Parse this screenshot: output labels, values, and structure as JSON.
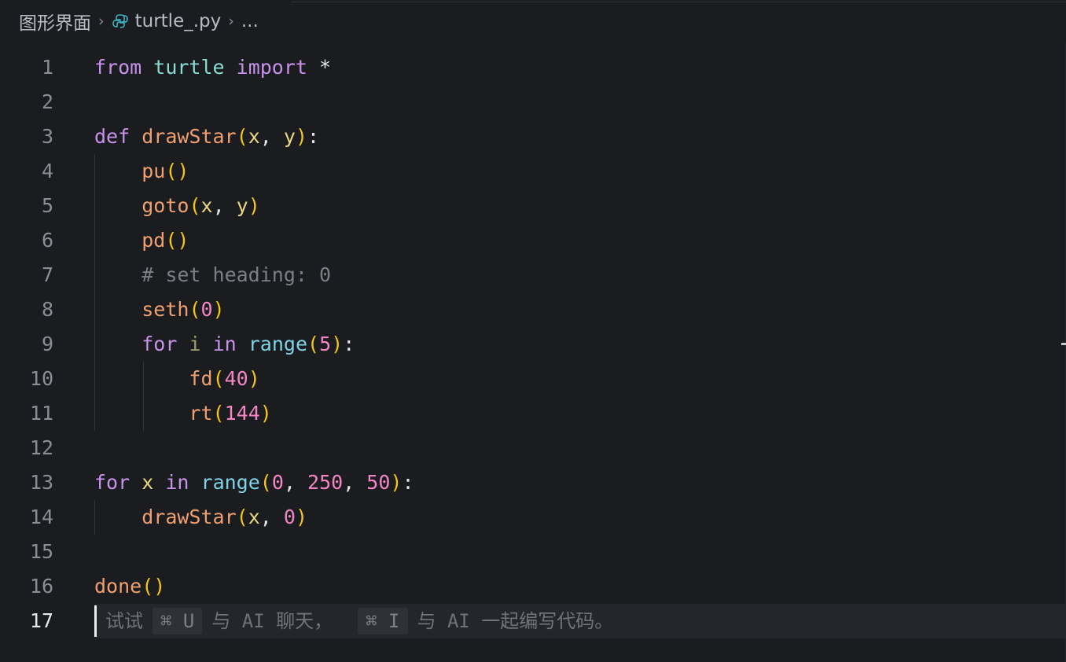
{
  "breadcrumb": {
    "folder": "图形界面",
    "file": "turtle_.py",
    "ellipsis": "..."
  },
  "editor": {
    "line_numbers": [
      "1",
      "2",
      "3",
      "4",
      "5",
      "6",
      "7",
      "8",
      "9",
      "10",
      "11",
      "12",
      "13",
      "14",
      "15",
      "16",
      "17"
    ],
    "current_line": 17,
    "lines": [
      [
        {
          "t": "from",
          "c": "kw"
        },
        {
          "t": " ",
          "c": "plain"
        },
        {
          "t": "turtle",
          "c": "mod"
        },
        {
          "t": " ",
          "c": "plain"
        },
        {
          "t": "import",
          "c": "kw"
        },
        {
          "t": " *",
          "c": "plain"
        }
      ],
      [],
      [
        {
          "t": "def",
          "c": "kw"
        },
        {
          "t": " ",
          "c": "plain"
        },
        {
          "t": "drawStar",
          "c": "fn"
        },
        {
          "t": "(",
          "c": "paren"
        },
        {
          "t": "x",
          "c": "var"
        },
        {
          "t": ", ",
          "c": "plain"
        },
        {
          "t": "y",
          "c": "var"
        },
        {
          "t": ")",
          "c": "paren"
        },
        {
          "t": ":",
          "c": "plain"
        }
      ],
      [
        {
          "t": "    ",
          "c": "plain"
        },
        {
          "t": "pu",
          "c": "fn"
        },
        {
          "t": "()",
          "c": "paren"
        }
      ],
      [
        {
          "t": "    ",
          "c": "plain"
        },
        {
          "t": "goto",
          "c": "fn"
        },
        {
          "t": "(",
          "c": "paren"
        },
        {
          "t": "x",
          "c": "var"
        },
        {
          "t": ", ",
          "c": "plain"
        },
        {
          "t": "y",
          "c": "var"
        },
        {
          "t": ")",
          "c": "paren"
        }
      ],
      [
        {
          "t": "    ",
          "c": "plain"
        },
        {
          "t": "pd",
          "c": "fn"
        },
        {
          "t": "()",
          "c": "paren"
        }
      ],
      [
        {
          "t": "    ",
          "c": "plain"
        },
        {
          "t": "# set heading: 0",
          "c": "cm"
        }
      ],
      [
        {
          "t": "    ",
          "c": "plain"
        },
        {
          "t": "seth",
          "c": "fn"
        },
        {
          "t": "(",
          "c": "paren"
        },
        {
          "t": "0",
          "c": "num"
        },
        {
          "t": ")",
          "c": "paren"
        }
      ],
      [
        {
          "t": "    ",
          "c": "plain"
        },
        {
          "t": "for",
          "c": "kw"
        },
        {
          "t": " ",
          "c": "plain"
        },
        {
          "t": "i",
          "c": "var-dim"
        },
        {
          "t": " ",
          "c": "plain"
        },
        {
          "t": "in",
          "c": "kw"
        },
        {
          "t": " ",
          "c": "plain"
        },
        {
          "t": "range",
          "c": "bi"
        },
        {
          "t": "(",
          "c": "paren"
        },
        {
          "t": "5",
          "c": "num"
        },
        {
          "t": ")",
          "c": "paren"
        },
        {
          "t": ":",
          "c": "plain"
        }
      ],
      [
        {
          "t": "        ",
          "c": "plain"
        },
        {
          "t": "fd",
          "c": "fn"
        },
        {
          "t": "(",
          "c": "paren"
        },
        {
          "t": "40",
          "c": "num"
        },
        {
          "t": ")",
          "c": "paren"
        }
      ],
      [
        {
          "t": "        ",
          "c": "plain"
        },
        {
          "t": "rt",
          "c": "fn"
        },
        {
          "t": "(",
          "c": "paren"
        },
        {
          "t": "144",
          "c": "num"
        },
        {
          "t": ")",
          "c": "paren"
        }
      ],
      [],
      [
        {
          "t": "for",
          "c": "kw"
        },
        {
          "t": " ",
          "c": "plain"
        },
        {
          "t": "x",
          "c": "var"
        },
        {
          "t": " ",
          "c": "plain"
        },
        {
          "t": "in",
          "c": "kw"
        },
        {
          "t": " ",
          "c": "plain"
        },
        {
          "t": "range",
          "c": "bi"
        },
        {
          "t": "(",
          "c": "paren"
        },
        {
          "t": "0",
          "c": "num"
        },
        {
          "t": ", ",
          "c": "plain"
        },
        {
          "t": "250",
          "c": "num"
        },
        {
          "t": ", ",
          "c": "plain"
        },
        {
          "t": "50",
          "c": "num"
        },
        {
          "t": ")",
          "c": "paren"
        },
        {
          "t": ":",
          "c": "plain"
        }
      ],
      [
        {
          "t": "    ",
          "c": "plain"
        },
        {
          "t": "drawStar",
          "c": "fn"
        },
        {
          "t": "(",
          "c": "paren"
        },
        {
          "t": "x",
          "c": "var"
        },
        {
          "t": ", ",
          "c": "plain"
        },
        {
          "t": "0",
          "c": "num"
        },
        {
          "t": ")",
          "c": "paren"
        }
      ],
      [],
      [
        {
          "t": "done",
          "c": "fn"
        },
        {
          "t": "()",
          "c": "paren"
        }
      ],
      []
    ]
  },
  "ai_hint": {
    "try": "试试",
    "chat_key": "⌘ U",
    "chat_text": "与 AI 聊天，",
    "write_key": "⌘ I",
    "write_text": "与 AI 一起编写代码。"
  },
  "icons": {
    "file_icon": "python-file-icon",
    "separator": "chevron-right-icon"
  },
  "colors": {
    "background": "#1b1c20",
    "keyword": "#c792ea",
    "function": "#f0a070",
    "builtin": "#7fd3e6",
    "variable": "#ead882",
    "number": "#f286c4",
    "bracket": "#f5c518",
    "comment": "#7b7f87"
  }
}
